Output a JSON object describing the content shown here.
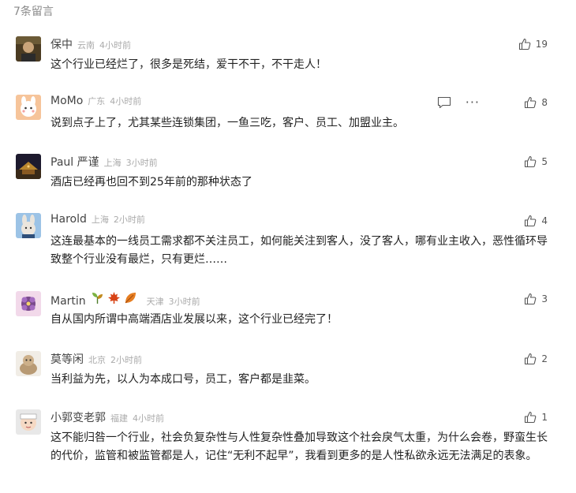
{
  "header": {
    "count_label": "7条留言"
  },
  "comments": [
    {
      "name": "保中",
      "region": "云南",
      "time": "4小时前",
      "likes": "19",
      "text": "这个行业已经烂了，很多是死结，爱干不干，不干走人！"
    },
    {
      "name": "MoMo",
      "region": "广东",
      "time": "4小时前",
      "likes": "8",
      "text": "说到点子上了，尤其某些连锁集团，一鱼三吃，客户、员工、加盟业主。"
    },
    {
      "name": "Paul 严谨",
      "region": "上海",
      "time": "3小时前",
      "likes": "5",
      "text": "酒店已经再也回不到25年前的那种状态了"
    },
    {
      "name": "Harold",
      "region": "上海",
      "time": "2小时前",
      "likes": "4",
      "text": "这连最基本的一线员工需求都不关注员工，如何能关注到客人，没了客人，哪有业主收入，恶性循环导致整个行业没有最烂，只有更烂……"
    },
    {
      "name": "Martin",
      "region": "天津",
      "time": "3小时前",
      "likes": "3",
      "text": "自从国内所谓中高端酒店业发展以来，这个行业已经完了！",
      "badges": [
        "sprout-icon",
        "maple-leaf-icon",
        "fallen-leaf-icon"
      ]
    },
    {
      "name": "莫等闲",
      "region": "北京",
      "time": "2小时前",
      "likes": "2",
      "text": "当利益为先，以人为本成口号，员工，客户都是韭菜。"
    },
    {
      "name": "小郭变老郭",
      "region": "福建",
      "time": "4小时前",
      "likes": "1",
      "text": "这不能归咎一个行业，社会负复杂性与人性复杂性叠加导致这个社会戾气太重，为什么会卷，野蛮生长的代价，监管和被监管都是人，记住“无利不起早”，我看到更多的是人性私欲永远无法满足的表象。"
    }
  ]
}
